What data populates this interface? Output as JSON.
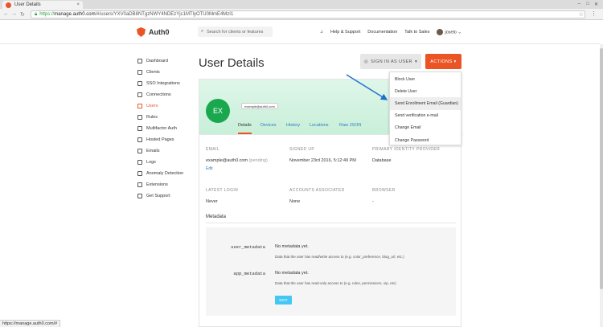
{
  "browser": {
    "tab_title": "User Details",
    "tab_close": "×",
    "url_secure": "https://",
    "url_host": "manage.auth0.com",
    "url_path": "/#/users/YXV0aDB8NTgzNWY4NDEzYjc1MTlyOTU0MmE4MzI1",
    "status_text": "https://manage.auth0.com/#"
  },
  "header": {
    "brand": "Auth0",
    "search_placeholder": "Search for clients or features",
    "links": [
      "Help & Support",
      "Documentation",
      "Talk to Sales"
    ],
    "username": "joselo"
  },
  "sidebar": {
    "items": [
      {
        "label": "Dashboard",
        "icon": "dashboard-icon"
      },
      {
        "label": "Clients",
        "icon": "clients-icon"
      },
      {
        "label": "SSO Integrations",
        "icon": "sso-icon"
      },
      {
        "label": "Connections",
        "icon": "connections-icon"
      },
      {
        "label": "Users",
        "icon": "users-icon",
        "active": true
      },
      {
        "label": "Rules",
        "icon": "rules-icon"
      },
      {
        "label": "Multifactor Auth",
        "icon": "multifactor-icon"
      },
      {
        "label": "Hosted Pages",
        "icon": "hosted-pages-icon"
      },
      {
        "label": "Emails",
        "icon": "emails-icon"
      },
      {
        "label": "Logs",
        "icon": "logs-icon"
      },
      {
        "label": "Anomaly Detection",
        "icon": "anomaly-icon"
      },
      {
        "label": "Extensions",
        "icon": "extensions-icon"
      },
      {
        "label": "Get Support",
        "icon": "support-icon"
      }
    ]
  },
  "main": {
    "title": "User Details",
    "signin_button": "SIGN IN AS USER",
    "actions_button": "ACTIONS",
    "actions_menu": [
      "Block User",
      "Delete User",
      "Send Enrollment Email (Guardian)",
      "Send verification e-mail",
      "Change Email",
      "Change Password"
    ],
    "highlighted_action": "Send Enrollment Email (Guardian)"
  },
  "profile": {
    "initials": "EX",
    "email_chip": "example@auth0.com",
    "tabs": [
      "Details",
      "Devices",
      "History",
      "Locations",
      "Raw JSON"
    ],
    "active_tab": "Details",
    "fields": {
      "email_label": "EMAIL",
      "email_value": "example@auth0.com",
      "email_status": "(pending)",
      "email_edit": "Edit",
      "signed_up_label": "SIGNED UP",
      "signed_up_value": "November 23rd 2016, 5:12:49 PM",
      "identity_label": "PRIMARY IDENTITY PROVIDER",
      "identity_value": "Database",
      "latest_login_label": "LATEST LOGIN",
      "latest_login_value": "Never",
      "accounts_label": "ACCOUNTS ASSOCIATED",
      "accounts_value": "None",
      "browser_label": "BROWSER",
      "browser_value": "-"
    },
    "metadata": {
      "section_title": "Metadata",
      "user_metadata_key": "user_metadata",
      "user_metadata_value": "No metadata yet.",
      "user_metadata_help": "Data that the user has read/write access to (e.g. color_preference, blog_url, etc.)",
      "app_metadata_key": "app_metadata",
      "app_metadata_value": "No metadata yet.",
      "app_metadata_help": "Data that the user has read-only access to (e.g. roles, permissions, vip, etc)",
      "edit_button": "EDIT"
    }
  },
  "colors": {
    "accent": "#eb5424",
    "link": "#2e7dbd",
    "avatar_green": "#1aa84f",
    "edit_blue": "#44c7f4"
  }
}
